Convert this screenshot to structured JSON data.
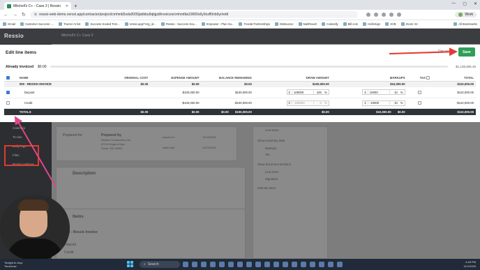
{
  "browser": {
    "tab_title": "Mitchell's C+ - Case 3 | Ressio",
    "url": "ressio-web-demo.vercel.app/contractor/project/cmhmb5xdu0000jubbbu9qbjpd/invoices/cmhmfda19000s6y0ozfl0nb9yr/edit",
    "profile": "Work",
    "bookmarks": [
      "Gmail",
      "Customer Success -...",
      "Tractor AI list",
      "Success Scaled Tem...",
      "ressio.app/?org_id...",
      "Ressio - Success Sca...",
      "Empower - Plan Su...",
      "Fractal Partnerships",
      "DeBounce",
      "MailReach",
      "Calendly",
      "Bill.com",
      "HelloSign",
      "SVB",
      "Zoom X2"
    ],
    "all_bookmarks": "All Bookmarks"
  },
  "app": {
    "logo": "Ressio",
    "breadcrumb": "Mitchell's C+ Case 3",
    "sidebar": [
      "Appointments",
      "Schedule",
      "Calendar",
      "To-dos",
      "Daily logs",
      "Files",
      "Project settings"
    ],
    "background": {
      "prepared_for": "Prepared for",
      "prepared_by": "Prepared by",
      "company": "Ressio Construction Inc.",
      "address_1": "676 N Dugout Hwy",
      "address_2": "Dover, DE 19901",
      "issued_on": "Issued on",
      "issued_date": "11/15/2025",
      "valid_until": "Valid until",
      "valid_date": "11/22/2025",
      "description": "Description",
      "items": "Items",
      "invoice_line": "000 - Ressio Invoice",
      "deposit": "Deposit",
      "credit": "Credit",
      "line_items_toggle": "Line items",
      "show_summary": "Show summary data",
      "markups": "Markups",
      "tax": "Tax",
      "show_doc_sections": "Show document sections",
      "signature": "Signature",
      "internal_notes": "Internal notes"
    }
  },
  "modal": {
    "title": "Edit line items",
    "discard_label": "Discard",
    "save_label": "Save",
    "already_invoiced_label": "Already invoiced",
    "already_invoiced_value": "$0.00",
    "already_invoiced_progress": 0,
    "invoice_total": "$1,135,506.45",
    "columns": [
      "NAME",
      "ORIGINAL COST",
      "EXPENSE AMOUNT",
      "BALANCE REMAINING",
      "DRAW AMOUNT",
      "MARKUPS",
      "TAX",
      "TOTAL"
    ],
    "group": {
      "name": "000 - RESSIO INVOICE",
      "original_cost": "$0.00",
      "expense_amount": "$0.00",
      "balance_remaining": "$0.00",
      "draw_amount": "$100,000.00",
      "markups": "$10,000.00",
      "total": "$110,000.00"
    },
    "rows": [
      {
        "name": "Deposit",
        "checked": true,
        "expense_amount": "$100,000.00",
        "balance_remaining": "$100,000.00",
        "draw_prefix": "$",
        "draw_value": "100000",
        "draw_pct": "100",
        "markup_prefix": "$",
        "markup_value": "10000",
        "markup_pct": "10",
        "total": "$110,000.00"
      },
      {
        "name": "Credit",
        "checked": false,
        "expense_amount": "-$100,000.00",
        "balance_remaining": "-$100,000.00",
        "draw_prefix": "$",
        "draw_value": "-100000",
        "draw_pct": "0",
        "markup_prefix": "$",
        "markup_value": "-10000",
        "markup_pct": "10",
        "total": "-$110,000.00"
      }
    ],
    "totals": {
      "label": "TOTALS",
      "original_cost": "$0.00",
      "expense_amount": "$0.00",
      "balance_remaining": "$0.00",
      "draw_amount": "$100,000.00",
      "draw_amount_2": "$0.00",
      "markups": "$10,000.00",
      "markups_2": "$0.00",
      "total": "$110,000.00"
    },
    "pct_symbol": "%"
  },
  "taskbar": {
    "weather_1": "Tonight to drop",
    "weather_2": "Tomorrow",
    "search_placeholder": "Search",
    "time": "4:48 PM",
    "date": "11/1/2025"
  },
  "colors": {
    "save_green": "#2f9e57",
    "annotation_red": "#e23a32",
    "annotation_pink": "#e0468a"
  }
}
